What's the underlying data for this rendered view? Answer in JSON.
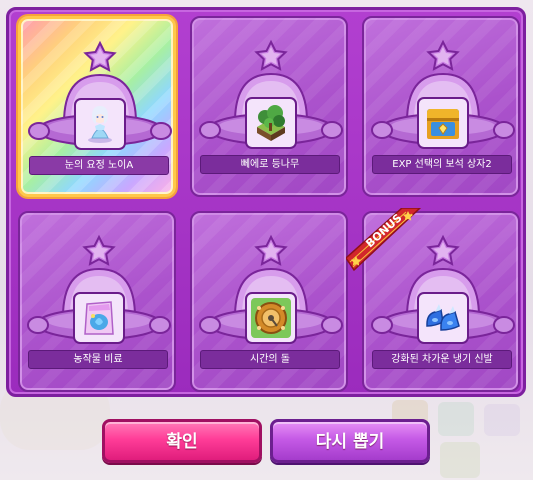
{
  "rewards": [
    {
      "label": "눈의 요정 노이A",
      "icon": "snow-fairy-noi-figure-icon",
      "selected": true,
      "bonus": false
    },
    {
      "label": "뻬에로 등나무",
      "icon": "leafy-tree-block-icon",
      "selected": false,
      "bonus": false
    },
    {
      "label": "EXP 선택의 보석 상자2",
      "icon": "treasure-chest-icon",
      "selected": false,
      "bonus": false
    },
    {
      "label": "농작물 비료",
      "icon": "fertilizer-bag-icon",
      "selected": false,
      "bonus": false
    },
    {
      "label": "시간의 돌",
      "icon": "stone-of-time-icon",
      "selected": false,
      "bonus": false
    },
    {
      "label": "강화된 차가운 냉기 신발",
      "icon": "frost-boots-icon",
      "selected": false,
      "bonus": true
    }
  ],
  "bonus_badge": "BONUS",
  "buttons": {
    "confirm": "확인",
    "redraw": "다시 뽑기"
  },
  "colors": {
    "panel": "#a33bc7",
    "card": "#b35ad2",
    "selected_border": "#ffc84a",
    "confirm_button": "#ff3d98",
    "redraw_button": "#c55ae6",
    "bonus_ribbon": "#d2262b"
  }
}
